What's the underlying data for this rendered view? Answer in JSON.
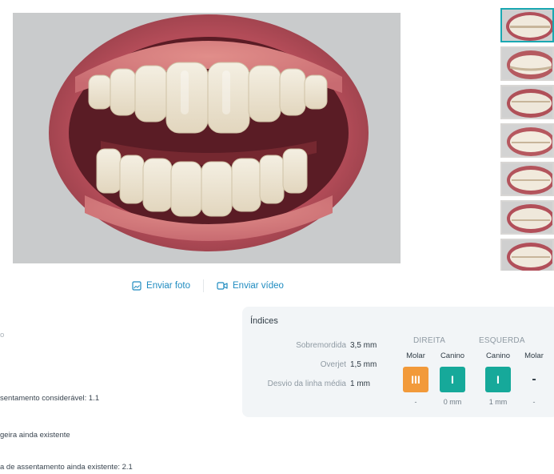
{
  "actions": {
    "send_photo": "Enviar foto",
    "send_video": "Enviar vídeo"
  },
  "left_text": [
    {
      "text": "o"
    },
    {
      "text": "sentamento considerável: 1.1"
    },
    {
      "text": "geira ainda existente"
    },
    {
      "text": "a de assentamento ainda existente: 2.1"
    }
  ],
  "indices": {
    "title": "Índices",
    "metrics": [
      {
        "label": "Sobremordida",
        "value": "3,5 mm"
      },
      {
        "label": "Overjet",
        "value": "1,5 mm"
      },
      {
        "label": "Desvio da linha média",
        "value": "1 mm"
      }
    ],
    "sides": [
      {
        "title": "DIREITA",
        "cols": [
          {
            "title": "Molar",
            "badge": "III",
            "color": "#f29a3a",
            "foot": "-"
          },
          {
            "title": "Canino",
            "badge": "I",
            "color": "#16a99a",
            "foot": "0 mm"
          }
        ]
      },
      {
        "title": "ESQUERDA",
        "cols": [
          {
            "title": "Canino",
            "badge": "I",
            "color": "#16a99a",
            "foot": "1 mm"
          },
          {
            "title": "Molar",
            "badge": "-",
            "color": "",
            "foot": "-"
          }
        ]
      }
    ]
  },
  "thumbnails": {
    "count": 7,
    "selected_index": 0
  }
}
